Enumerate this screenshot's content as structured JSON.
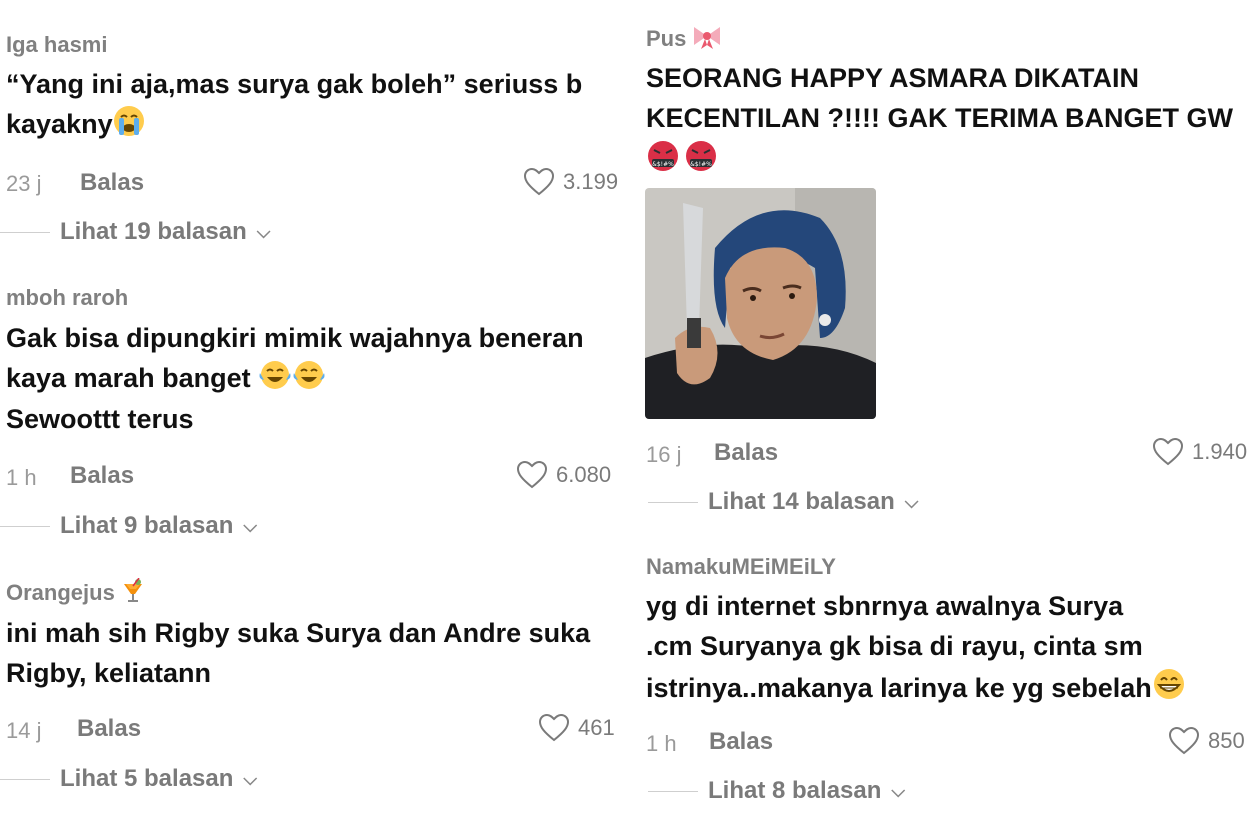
{
  "comments_left": [
    {
      "username": "Iga hasmi",
      "lines": [
        "“Yang ini aja,mas surya gak boleh” seriuss b",
        "kayakny"
      ],
      "time": "23 j",
      "reply_label": "Balas",
      "likes": "3.199",
      "view_replies": "Lihat 19 balasan"
    },
    {
      "username": "mboh raroh",
      "lines": [
        "Gak bisa dipungkiri mimik wajahnya beneran",
        "kaya marah banget",
        "Sewoottt terus"
      ],
      "time": "1 h",
      "reply_label": "Balas",
      "likes": "6.080",
      "view_replies": "Lihat 9 balasan"
    },
    {
      "username": "Orangejus",
      "lines": [
        "ini mah sih Rigby suka Surya dan Andre suka",
        "Rigby, keliatann"
      ],
      "time": "14 j",
      "reply_label": "Balas",
      "likes": "461",
      "view_replies": "Lihat 5 balasan"
    }
  ],
  "comments_right": [
    {
      "username": "Pus",
      "lines": [
        "SEORANG HAPPY ASMARA DIKATAIN",
        "KECENTILAN ?!!!! GAK TERIMA BANGET GW"
      ],
      "time": "16 j",
      "reply_label": "Balas",
      "likes": "1.940",
      "view_replies": "Lihat 14 balasan"
    },
    {
      "username": "NamakuMEiMEiLY",
      "lines": [
        "yg di internet sbnrnya awalnya Surya",
        ".cm Suryanya gk bisa di rayu, cinta sm",
        "istrinya..makanya larinya ke yg sebelah"
      ],
      "time": "1 h",
      "reply_label": "Balas",
      "likes": "850",
      "view_replies": "Lihat 8 balasan"
    }
  ],
  "icons": {
    "heart": "heart-outline-icon",
    "chevron": "chevron-down-icon",
    "crying": "loudly-crying-face-emoji",
    "tears_joy": "face-with-tears-of-joy-emoji",
    "cocktail": "tropical-drink-emoji",
    "ribbon": "ribbon-emoji",
    "cursing": "face-with-symbols-on-mouth-emoji",
    "grin": "beaming-face-emoji"
  },
  "colors": {
    "text": "#111111",
    "muted": "#7a7a7a",
    "username": "#808080",
    "divider": "#cfcfcf"
  }
}
